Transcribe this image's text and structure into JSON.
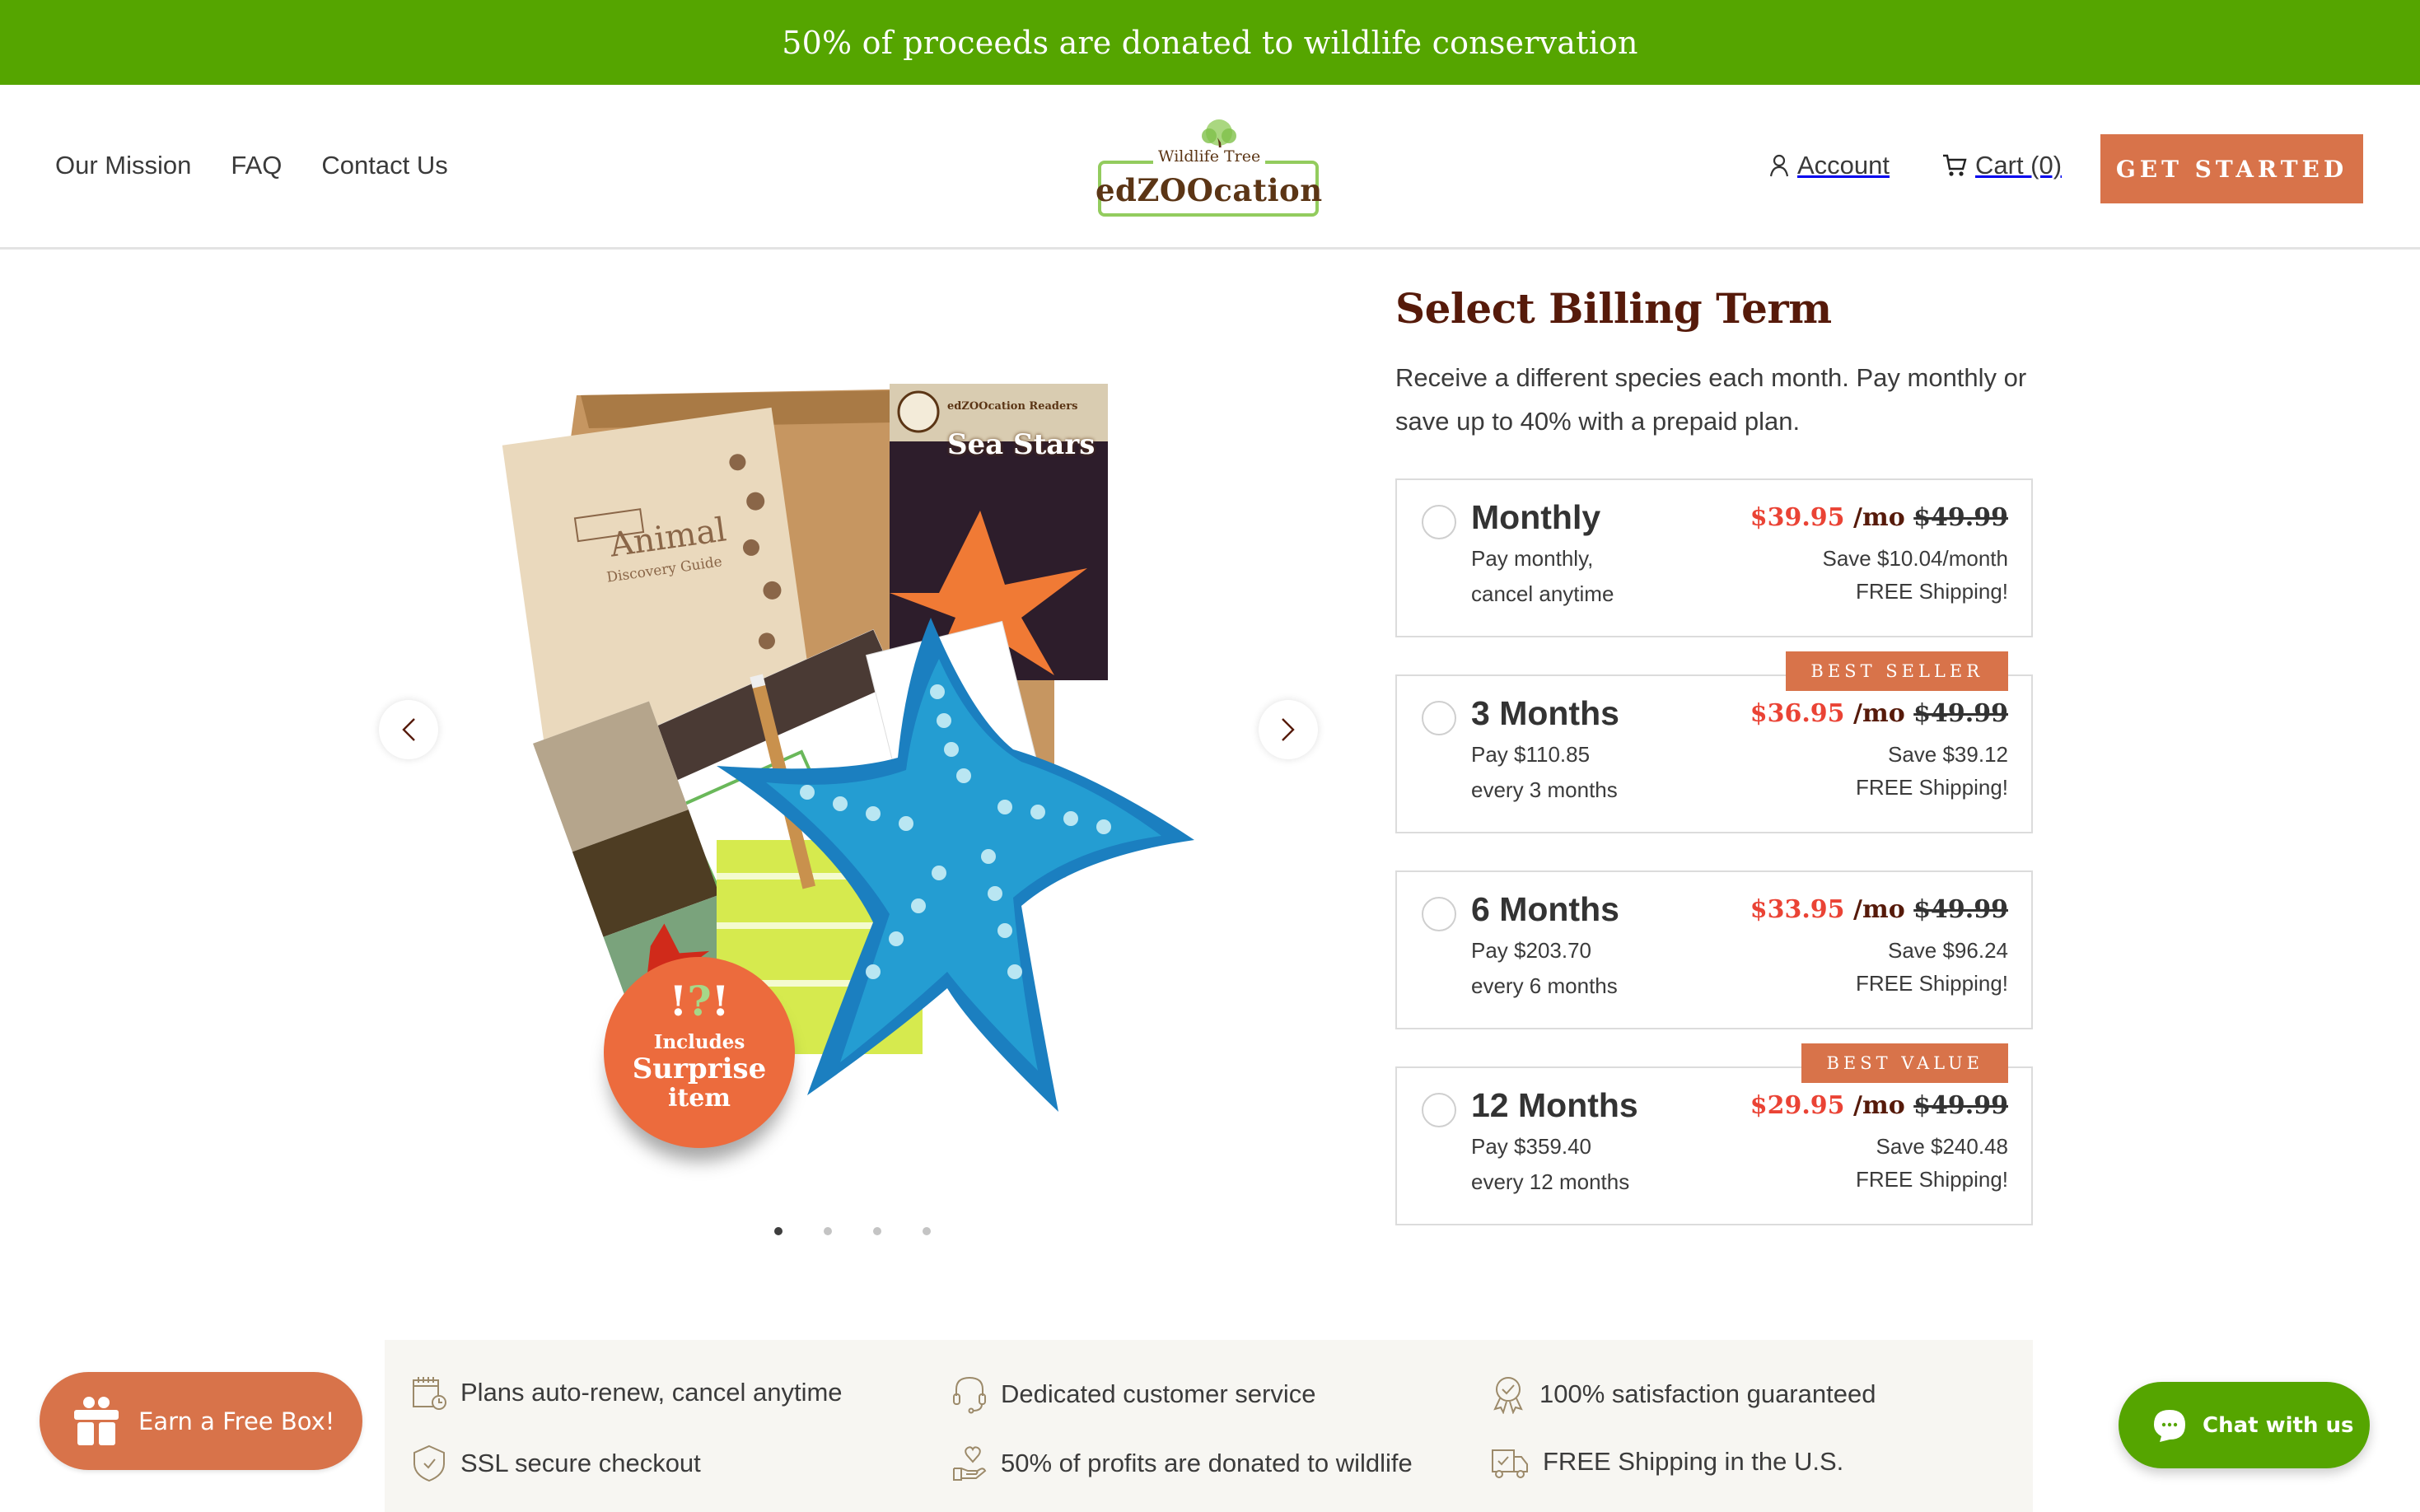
{
  "announcement": {
    "text": "50% of proceeds are donated to wildlife conservation"
  },
  "header": {
    "nav_left": [
      {
        "label": "Our Mission"
      },
      {
        "label": "FAQ"
      },
      {
        "label": "Contact Us"
      }
    ],
    "logo": {
      "tagline": "Wildlife Tree",
      "name": "edZOOcation"
    },
    "account_label": "Account",
    "cart_label": "Cart (0)",
    "cta_label": "GET STARTED"
  },
  "carousel": {
    "product_image": {
      "book1_title": "Animal",
      "book1_subtitle": "Discovery Guide",
      "book2_series": "edZOOcation Readers",
      "book2_title": "Sea Stars",
      "badge_marks": [
        "!",
        "?",
        "!"
      ],
      "badge_line1": "Includes",
      "badge_line2": "Surprise",
      "badge_line3": "item"
    },
    "slide_count": 4,
    "active_slide": 1
  },
  "billing": {
    "title": "Select Billing Term",
    "description": "Receive a different species each month. Pay monthly or save up to 40% with a prepaid plan.",
    "plans": [
      {
        "term": "Monthly",
        "line1": "Pay monthly,",
        "line2": "cancel anytime",
        "price": "$39.95",
        "per": "/mo",
        "was": "$49.99",
        "save": "Save $10.04/month",
        "shipping": "FREE Shipping!",
        "badge": "",
        "selected": false
      },
      {
        "term": "3 Months",
        "line1": "Pay $110.85",
        "line2": "every 3 months",
        "price": "$36.95",
        "per": "/mo",
        "was": "$49.99",
        "save": "Save $39.12",
        "shipping": "FREE Shipping!",
        "badge": "BEST SELLER",
        "selected": false
      },
      {
        "term": "6 Months",
        "line1": "Pay $203.70",
        "line2": "every 6 months",
        "price": "$33.95",
        "per": "/mo",
        "was": "$49.99",
        "save": "Save $96.24",
        "shipping": "FREE Shipping!",
        "badge": "",
        "selected": false
      },
      {
        "term": "12 Months",
        "line1": "Pay $359.40",
        "line2": "every 12 months",
        "price": "$29.95",
        "per": "/mo",
        "was": "$49.99",
        "save": "Save $240.48",
        "shipping": "FREE Shipping!",
        "badge": "BEST VALUE",
        "selected": false
      }
    ]
  },
  "features": [
    {
      "icon": "calendar-clock-icon",
      "text": "Plans auto-renew, cancel anytime"
    },
    {
      "icon": "headset-icon",
      "text": "Dedicated customer service"
    },
    {
      "icon": "award-ribbon-icon",
      "text": "100% satisfaction guaranteed"
    },
    {
      "icon": "shield-check-icon",
      "text": "SSL secure checkout"
    },
    {
      "icon": "heart-hand-icon",
      "text": "50% of profits are donated to wildlife"
    },
    {
      "icon": "delivery-truck-icon",
      "text": "FREE Shipping in the U.S."
    }
  ],
  "widgets": {
    "earn_label": "Earn a Free Box!",
    "chat_label": "Chat with us"
  },
  "colors": {
    "brand_green": "#55a500",
    "accent_orange": "#d8734a",
    "heading_brown": "#561a0a",
    "sale_red": "#ea4335",
    "feature_bg": "#f7f6f2"
  }
}
